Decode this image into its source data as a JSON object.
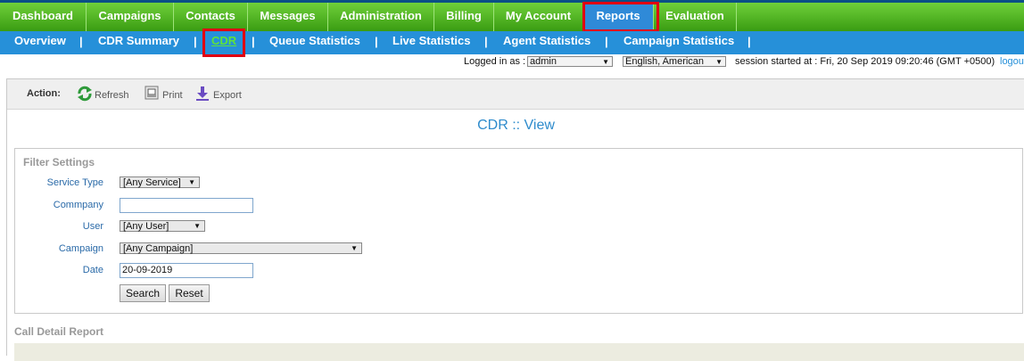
{
  "topnav": {
    "tabs": [
      {
        "label": "Dashboard"
      },
      {
        "label": "Campaigns"
      },
      {
        "label": "Contacts"
      },
      {
        "label": "Messages"
      },
      {
        "label": "Administration"
      },
      {
        "label": "Billing"
      },
      {
        "label": "My Account"
      },
      {
        "label": "Reports"
      },
      {
        "label": "Evaluation"
      }
    ],
    "active": "Reports"
  },
  "subnav": {
    "items": [
      {
        "label": "Overview"
      },
      {
        "label": "CDR Summary"
      },
      {
        "label": "CDR"
      },
      {
        "label": "Queue Statistics"
      },
      {
        "label": "Live Statistics"
      },
      {
        "label": "Agent Statistics"
      },
      {
        "label": "Campaign Statistics"
      }
    ],
    "separator": "|",
    "current": "CDR"
  },
  "login": {
    "prefix": "Logged in as :",
    "user": "admin",
    "language": "English, American",
    "session": "session started at : Fri, 20 Sep 2019 09:20:46 (GMT +0500)",
    "logout": "logout"
  },
  "actions": {
    "label": "Action:",
    "refresh": "Refresh",
    "print": "Print",
    "export": "Export"
  },
  "page_title": "CDR :: View",
  "filter": {
    "title": "Filter Settings",
    "service_type_label": "Service Type",
    "service_type_value": "[Any Service]",
    "company_label": "Commpany",
    "company_value": "",
    "user_label": "User",
    "user_value": "[Any User]",
    "campaign_label": "Campaign",
    "campaign_value": "[Any Campaign]",
    "date_label": "Date",
    "date_value": "20-09-2019",
    "search_button": "Search",
    "reset_button": "Reset"
  },
  "report": {
    "title": "Call Detail Report"
  },
  "colors": {
    "topnav_green": "#4cb020",
    "subnav_blue": "#2690d9",
    "highlight_red": "#e00012",
    "title_blue": "#2e8bcc"
  }
}
